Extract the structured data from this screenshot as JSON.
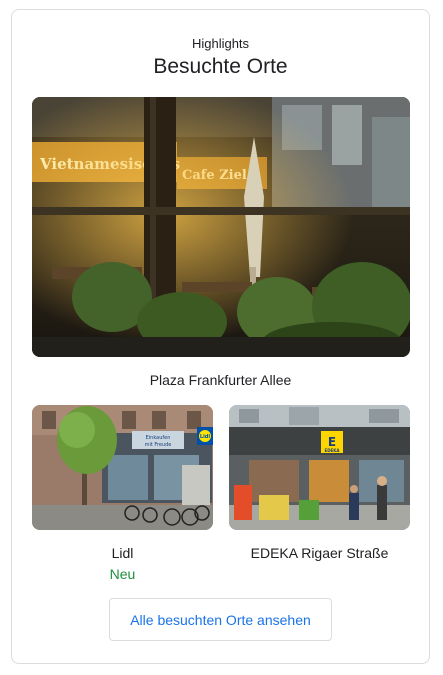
{
  "header": {
    "kicker": "Highlights",
    "title": "Besuchte Orte"
  },
  "places": {
    "main": {
      "name": "Plaza Frankfurter Allee",
      "sign_left": "Vietnamesisches Restaurant",
      "sign_right": "Cafe Ziel"
    },
    "lidl": {
      "name": "Lidl",
      "badge": "Neu",
      "sign_text": "Einkaufen mit Freude",
      "logo_text": "Lidl"
    },
    "edeka": {
      "name": "EDEKA Rigaer Straße",
      "logo_text": "EDEKA"
    }
  },
  "actions": {
    "all_places_label": "Alle besuchten Orte ansehen"
  },
  "colors": {
    "accent": "#1a73e8",
    "new_badge": "#1e8e3e",
    "border": "#dadce0"
  }
}
